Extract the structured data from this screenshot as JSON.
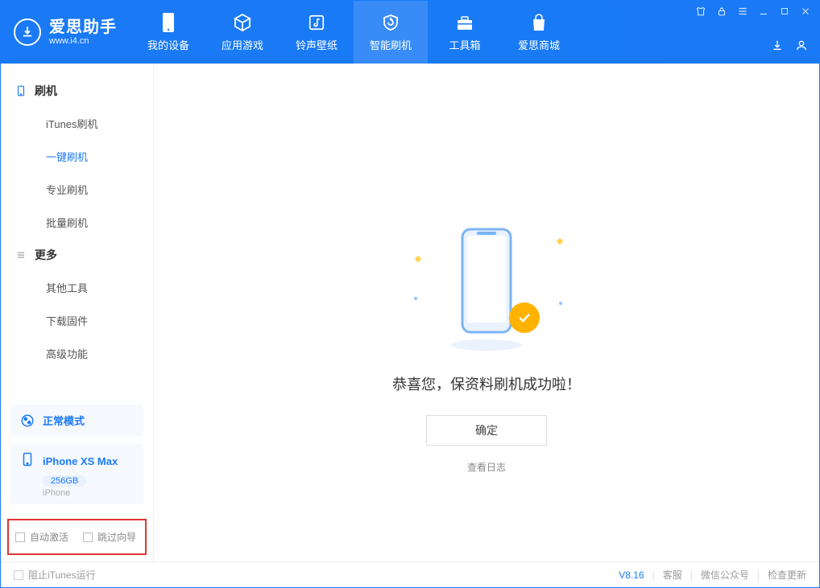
{
  "app": {
    "name_cn": "爱思助手",
    "name_en": "www.i4.cn"
  },
  "nav": {
    "items": [
      {
        "label": "我的设备"
      },
      {
        "label": "应用游戏"
      },
      {
        "label": "铃声壁纸"
      },
      {
        "label": "智能刷机"
      },
      {
        "label": "工具箱"
      },
      {
        "label": "爱思商城"
      }
    ],
    "active_index": 3
  },
  "sidebar": {
    "sections": [
      {
        "title": "刷机",
        "items": [
          {
            "label": "iTunes刷机"
          },
          {
            "label": "一键刷机"
          },
          {
            "label": "专业刷机"
          },
          {
            "label": "批量刷机"
          }
        ],
        "active_index": 1
      },
      {
        "title": "更多",
        "items": [
          {
            "label": "其他工具"
          },
          {
            "label": "下载固件"
          },
          {
            "label": "高级功能"
          }
        ]
      }
    ],
    "mode_card": {
      "label": "正常模式"
    },
    "device_card": {
      "name": "iPhone XS Max",
      "capacity": "256GB",
      "type": "iPhone"
    },
    "checks": {
      "auto_activate": "自动激活",
      "skip_guide": "跳过向导"
    }
  },
  "main": {
    "success_msg": "恭喜您，保资料刷机成功啦！",
    "ok_label": "确定",
    "log_link": "查看日志"
  },
  "footer": {
    "block_itunes": "阻止iTunes运行",
    "version": "V8.16",
    "links": {
      "service": "客服",
      "wechat": "微信公众号",
      "update": "检查更新"
    }
  }
}
